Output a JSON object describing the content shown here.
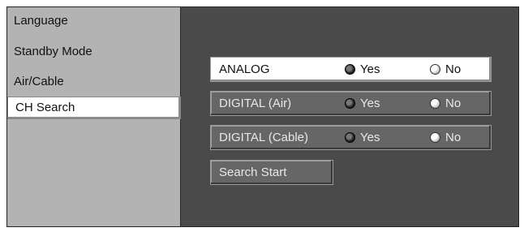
{
  "sidebar": {
    "items": [
      {
        "label": "Language"
      },
      {
        "label": "Standby Mode"
      },
      {
        "label": "Air/Cable"
      },
      {
        "label": "CH Search"
      }
    ],
    "selected": "CH Search"
  },
  "search": {
    "rows": [
      {
        "label": "ANALOG",
        "yes": "Yes",
        "no": "No",
        "selected": "Yes"
      },
      {
        "label": "DIGITAL (Air)",
        "yes": "Yes",
        "no": "No",
        "selected": "Yes"
      },
      {
        "label": "DIGITAL (Cable)",
        "yes": "Yes",
        "no": "No",
        "selected": "Yes"
      }
    ],
    "start_button": "Search Start"
  }
}
